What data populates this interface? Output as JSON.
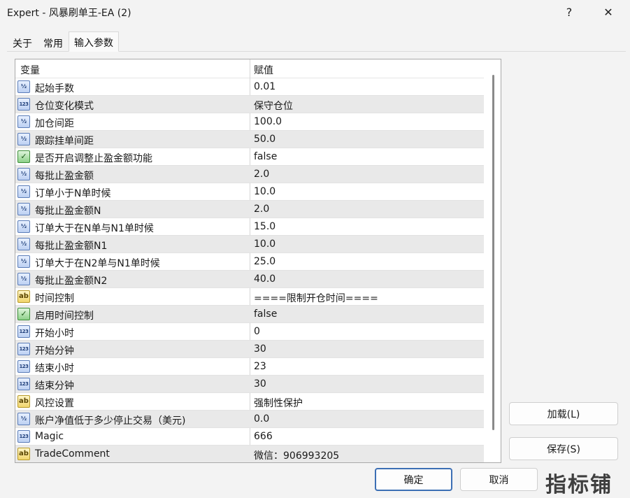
{
  "window": {
    "title": "Expert - 风暴刷单王-EA (2)",
    "help_glyph": "?",
    "close_glyph": "✕"
  },
  "tabs": [
    {
      "label": "关于"
    },
    {
      "label": "常用"
    },
    {
      "label": "输入参数"
    }
  ],
  "grid": {
    "header": {
      "col1": "变量",
      "col2": "赋值"
    },
    "rows": [
      {
        "icon": "V2",
        "name": "起始手数",
        "value": "0.01"
      },
      {
        "icon": "123",
        "name": "仓位变化模式",
        "value": "保守仓位"
      },
      {
        "icon": "V2",
        "name": "加仓间距",
        "value": "100.0"
      },
      {
        "icon": "V2",
        "name": "跟踪挂单间距",
        "value": "50.0"
      },
      {
        "icon": "bool",
        "name": "是否开启调整止盈金额功能",
        "value": "false"
      },
      {
        "icon": "V2",
        "name": "每批止盈金额",
        "value": "2.0"
      },
      {
        "icon": "V2",
        "name": "订单小于N单时候",
        "value": "10.0"
      },
      {
        "icon": "V2",
        "name": "每批止盈金额N",
        "value": "2.0"
      },
      {
        "icon": "V2",
        "name": "订单大于在N单与N1单时候",
        "value": "15.0"
      },
      {
        "icon": "V2",
        "name": "每批止盈金额N1",
        "value": "10.0"
      },
      {
        "icon": "V2",
        "name": "订单大于在N2单与N1单时候",
        "value": "25.0"
      },
      {
        "icon": "V2",
        "name": "每批止盈金额N2",
        "value": "40.0"
      },
      {
        "icon": "ab",
        "name": "时间控制",
        "value": "====限制开仓时间===="
      },
      {
        "icon": "bool",
        "name": "启用时间控制",
        "value": "false"
      },
      {
        "icon": "123",
        "name": "开始小时",
        "value": "0"
      },
      {
        "icon": "123",
        "name": "开始分钟",
        "value": "30"
      },
      {
        "icon": "123",
        "name": "结束小时",
        "value": "23"
      },
      {
        "icon": "123",
        "name": "结束分钟",
        "value": "30"
      },
      {
        "icon": "ab",
        "name": "风控设置",
        "value": "强制性保护"
      },
      {
        "icon": "V2",
        "name": "账户净值低于多少停止交易（美元)",
        "value": "0.0"
      },
      {
        "icon": "123",
        "name": "Magic",
        "value": "666"
      },
      {
        "icon": "ab",
        "name": "TradeComment",
        "value": "微信：906993205"
      }
    ]
  },
  "buttons": {
    "load": "加载(L)",
    "save": "保存(S)",
    "ok": "确定",
    "cancel": "取消"
  },
  "watermark": "指标铺"
}
